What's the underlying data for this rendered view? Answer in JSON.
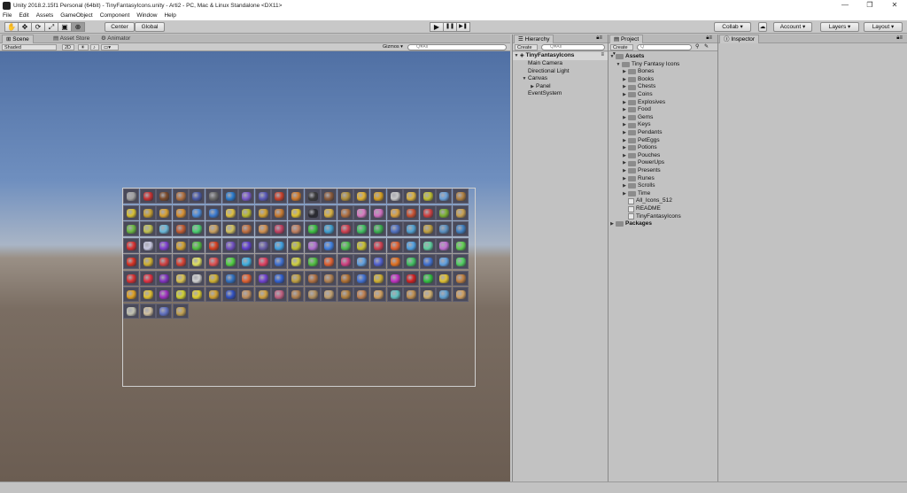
{
  "window": {
    "title": "Unity 2018.2.15f1 Personal (64bit) - TinyFantasyIcons.unity - Arti2 - PC, Mac & Linux Standalone <DX11>",
    "minimize": "—",
    "restore": "❐",
    "close": "✕"
  },
  "menu": [
    "File",
    "Edit",
    "Assets",
    "GameObject",
    "Component",
    "Window",
    "Help"
  ],
  "toolbar": {
    "pivot_label": "Center",
    "space_label": "Global",
    "play_icon": "▶",
    "pause_icon": "❚❚",
    "step_icon": "▶❚",
    "collab_label": "Collab ▾",
    "account_label": "Account",
    "layers_label": "Layers",
    "layout_label": "Layout"
  },
  "scene_panel": {
    "tabs": [
      "Scene",
      "Asset Store",
      "Animator"
    ],
    "shading": "Shaded",
    "mode_2d": "2D",
    "gizmos": "Gizmos ▾",
    "search_placeholder": "Q▾All"
  },
  "hierarchy": {
    "tab": "Hierarchy",
    "create": "Create ▾",
    "search_placeholder": "Q▾All",
    "scene_name": "TinyFantasyIcons",
    "items": [
      {
        "label": "Main Camera",
        "depth": 1,
        "arrow": ""
      },
      {
        "label": "Directional Light",
        "depth": 1,
        "arrow": ""
      },
      {
        "label": "Canvas",
        "depth": 1,
        "arrow": "▼"
      },
      {
        "label": "Panel",
        "depth": 2,
        "arrow": "▶"
      },
      {
        "label": "EventSystem",
        "depth": 1,
        "arrow": ""
      }
    ]
  },
  "project": {
    "tab": "Project",
    "create": "Create ▾",
    "search_placeholder": "",
    "root": "Assets",
    "pack": "Tiny Fantasy Icons",
    "folders": [
      "Bones",
      "Books",
      "Chests",
      "Coins",
      "Explosives",
      "Food",
      "Gems",
      "Keys",
      "Pendants",
      "PetEggs",
      "Potions",
      "Pouches",
      "PowerUps",
      "Presents",
      "Runes",
      "Scrolls",
      "Time"
    ],
    "files": [
      "All_Icons_512",
      "README",
      "TinyFantasyIcons"
    ],
    "packages": "Packages"
  },
  "inspector": {
    "tab": "Inspector"
  },
  "icon_rows": [
    [
      "#a0a0a0",
      "#c83030",
      "#7a4a2a",
      "#b07040",
      "#4a5aa8",
      "#6a6a6a",
      "#2a7acc",
      "#7a5acc",
      "#5a5ab8",
      "#c8402a",
      "#d07a2a",
      "#3a3a3a",
      "#8a5a3a",
      "#b0903a",
      "#e0b030",
      "#d8a020",
      "#c8c8c8",
      "#d8b040",
      "#c0c030",
      "#6aa0d8",
      "#b08040"
    ],
    [
      "#d8c030",
      "#c8a030",
      "#d8a030",
      "#d89030",
      "#4a8ad8",
      "#3a7ad0",
      "#e0c040",
      "#b8b830",
      "#d0a030",
      "#c87a30",
      "#e0c030",
      "#2a2a30",
      "#d8b040",
      "#b07040",
      "#d87ac0",
      "#d070c0",
      "#d8a040",
      "#c85030",
      "#d04040",
      "#7ab030",
      "#c8a050"
    ],
    [
      "#6ab840",
      "#c0c050",
      "#6ab8d8",
      "#c05a30",
      "#4ad070",
      "#c8a060",
      "#d0c060",
      "#c07040",
      "#d09050",
      "#c04060",
      "#c08060",
      "#3ac040",
      "#40a0d0",
      "#d04050",
      "#40c060",
      "#3ab050",
      "#5070c0",
      "#50a0d0",
      "#c0a040",
      "#5a90c0",
      "#4080c0"
    ],
    [
      "#d83030",
      "#c8c8e0",
      "#8040d0",
      "#d0a030",
      "#50c040",
      "#d84020",
      "#7050c0",
      "#6040d0",
      "#6a60a8",
      "#40a0e0",
      "#c0c030",
      "#b070d0",
      "#4080e0",
      "#50c050",
      "#c8c030",
      "#d04050",
      "#e06030",
      "#50a0e0",
      "#60d0a0",
      "#c070d0",
      "#60d050"
    ],
    [
      "#d83020",
      "#d0b030",
      "#d04040",
      "#d84030",
      "#e0e060",
      "#e05050",
      "#50d040",
      "#40b0e0",
      "#e04060",
      "#4070d0",
      "#d0d040",
      "#50c040",
      "#e06030",
      "#d04080",
      "#60a0e0",
      "#5060d0",
      "#e07020",
      "#40c060",
      "#4070d0",
      "#60a0e0",
      "#50d060"
    ],
    [
      "#d83030",
      "#e03040",
      "#8030c0",
      "#d8c050",
      "#d0d0d0",
      "#d0b030",
      "#3070c0",
      "#e06030",
      "#7040d0",
      "#3060d0",
      "#c0a040",
      "#b07040",
      "#b08050",
      "#b07030",
      "#4070d0",
      "#d0b030",
      "#c030c0",
      "#d02020",
      "#30c040",
      "#e0c030",
      "#c08040"
    ],
    [
      "#e0a020",
      "#e0c030",
      "#a030c0",
      "#d0d030",
      "#e0d030",
      "#d0a030",
      "#3050c0",
      "#c09060",
      "#d0a040",
      "#c06080",
      "#b08050",
      "#b09060",
      "#c0a070",
      "#b08040",
      "#c08050",
      "#d0a060",
      "#60c0c0",
      "#c09050",
      "#d0b070",
      "#60a0d0",
      "#d0a060"
    ],
    [
      "#c0c0b0",
      "#d0c0a0",
      "#6070c0",
      "#c0a050"
    ]
  ]
}
